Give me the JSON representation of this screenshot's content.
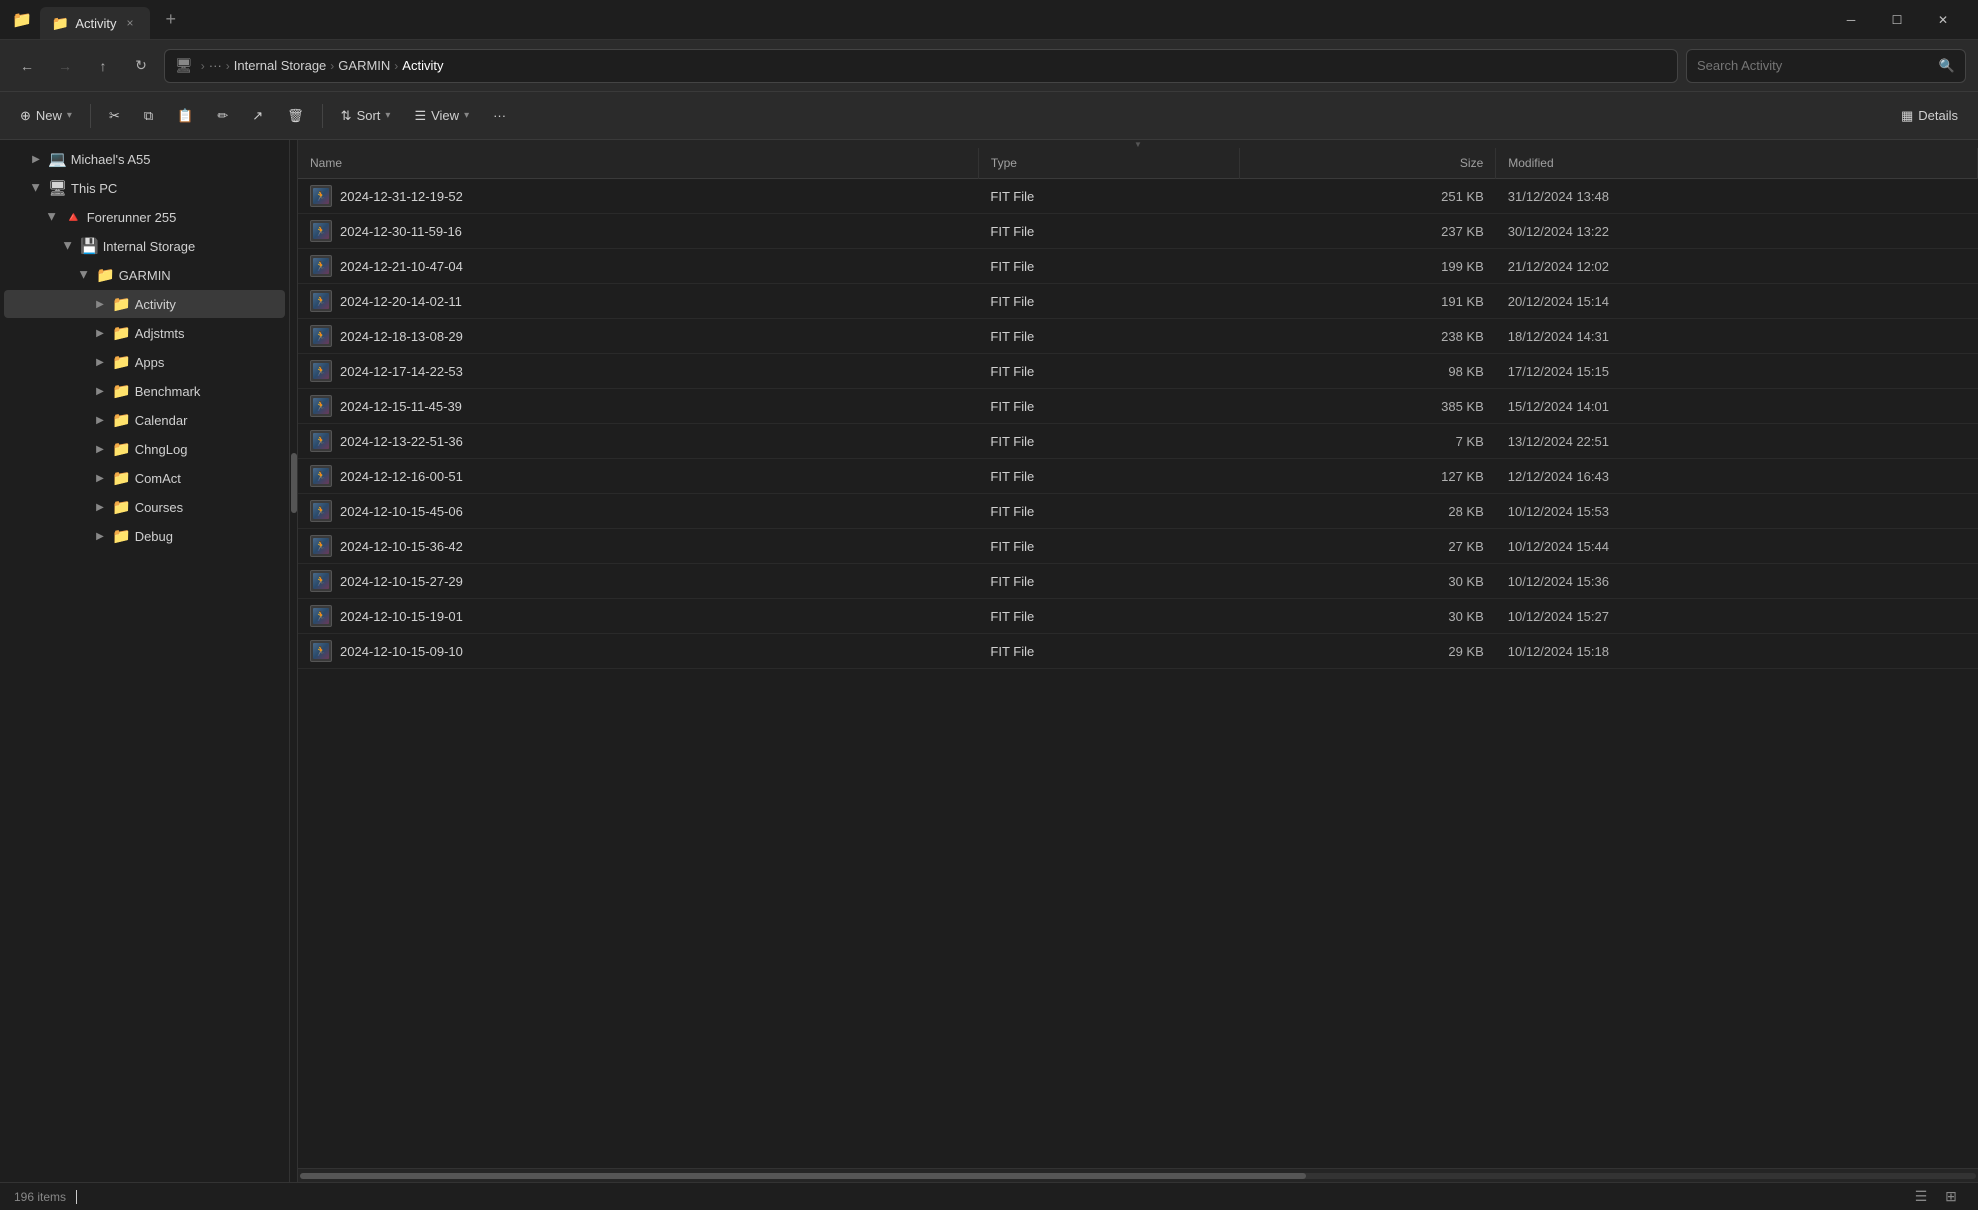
{
  "window": {
    "title": "Activity",
    "tab_close": "×",
    "tab_add": "+",
    "min": "─",
    "max": "☐",
    "close": "✕"
  },
  "address_bar": {
    "back_disabled": false,
    "forward_disabled": true,
    "up": "↑",
    "refresh": "↻",
    "breadcrumb": {
      "monitor": "🖥",
      "path": [
        "Internal Storage",
        "GARMIN",
        "Activity"
      ]
    },
    "search_placeholder": "Search Activity"
  },
  "toolbar": {
    "new_label": "New",
    "sort_label": "Sort",
    "view_label": "View",
    "details_label": "Details",
    "more": "···"
  },
  "sidebar": {
    "items": [
      {
        "id": "michaels-a55",
        "label": "Michael's A55",
        "indent": 1,
        "icon": "💻",
        "arrow": "▶",
        "expanded": false
      },
      {
        "id": "this-pc",
        "label": "This PC",
        "indent": 1,
        "icon": "🖥",
        "arrow": "▼",
        "expanded": true
      },
      {
        "id": "forerunner",
        "label": "Forerunner 255",
        "indent": 2,
        "icon": "🔺",
        "arrow": "▼",
        "expanded": true
      },
      {
        "id": "internal-storage",
        "label": "Internal Storage",
        "indent": 3,
        "icon": "💾",
        "arrow": "▼",
        "expanded": true
      },
      {
        "id": "garmin",
        "label": "GARMIN",
        "indent": 4,
        "icon": "📁",
        "arrow": "▼",
        "expanded": true
      },
      {
        "id": "activity",
        "label": "Activity",
        "indent": 5,
        "icon": "📁",
        "arrow": "▶",
        "expanded": false,
        "active": true
      },
      {
        "id": "adjstmts",
        "label": "Adjstmts",
        "indent": 5,
        "icon": "📁",
        "arrow": "▶",
        "expanded": false
      },
      {
        "id": "apps",
        "label": "Apps",
        "indent": 5,
        "icon": "📁",
        "arrow": "▶",
        "expanded": false
      },
      {
        "id": "benchmark",
        "label": "Benchmark",
        "indent": 5,
        "icon": "📁",
        "arrow": "▶",
        "expanded": false
      },
      {
        "id": "calendar",
        "label": "Calendar",
        "indent": 5,
        "icon": "📁",
        "arrow": "▶",
        "expanded": false
      },
      {
        "id": "chnglog",
        "label": "ChngLog",
        "indent": 5,
        "icon": "📁",
        "arrow": "▶",
        "expanded": false
      },
      {
        "id": "comact",
        "label": "ComAct",
        "indent": 5,
        "icon": "📁",
        "arrow": "▶",
        "expanded": false
      },
      {
        "id": "courses",
        "label": "Courses",
        "indent": 5,
        "icon": "📁",
        "arrow": "▶",
        "expanded": false
      },
      {
        "id": "debug",
        "label": "Debug",
        "indent": 5,
        "icon": "📁",
        "arrow": "▶",
        "expanded": false
      }
    ]
  },
  "file_list": {
    "columns": [
      "Name",
      "Type",
      "Size",
      "Modified"
    ],
    "files": [
      {
        "name": "2024-12-31-12-19-52",
        "type": "FIT File",
        "size": "251 KB",
        "modified": "31/12/2024 13:48"
      },
      {
        "name": "2024-12-30-11-59-16",
        "type": "FIT File",
        "size": "237 KB",
        "modified": "30/12/2024 13:22"
      },
      {
        "name": "2024-12-21-10-47-04",
        "type": "FIT File",
        "size": "199 KB",
        "modified": "21/12/2024 12:02"
      },
      {
        "name": "2024-12-20-14-02-11",
        "type": "FIT File",
        "size": "191 KB",
        "modified": "20/12/2024 15:14"
      },
      {
        "name": "2024-12-18-13-08-29",
        "type": "FIT File",
        "size": "238 KB",
        "modified": "18/12/2024 14:31"
      },
      {
        "name": "2024-12-17-14-22-53",
        "type": "FIT File",
        "size": "98 KB",
        "modified": "17/12/2024 15:15"
      },
      {
        "name": "2024-12-15-11-45-39",
        "type": "FIT File",
        "size": "385 KB",
        "modified": "15/12/2024 14:01"
      },
      {
        "name": "2024-12-13-22-51-36",
        "type": "FIT File",
        "size": "7 KB",
        "modified": "13/12/2024 22:51"
      },
      {
        "name": "2024-12-12-16-00-51",
        "type": "FIT File",
        "size": "127 KB",
        "modified": "12/12/2024 16:43"
      },
      {
        "name": "2024-12-10-15-45-06",
        "type": "FIT File",
        "size": "28 KB",
        "modified": "10/12/2024 15:53"
      },
      {
        "name": "2024-12-10-15-36-42",
        "type": "FIT File",
        "size": "27 KB",
        "modified": "10/12/2024 15:44"
      },
      {
        "name": "2024-12-10-15-27-29",
        "type": "FIT File",
        "size": "30 KB",
        "modified": "10/12/2024 15:36"
      },
      {
        "name": "2024-12-10-15-19-01",
        "type": "FIT File",
        "size": "30 KB",
        "modified": "10/12/2024 15:27"
      },
      {
        "name": "2024-12-10-15-09-10",
        "type": "FIT File",
        "size": "29 KB",
        "modified": "10/12/2024 15:18"
      }
    ]
  },
  "status_bar": {
    "count": "196 items"
  }
}
